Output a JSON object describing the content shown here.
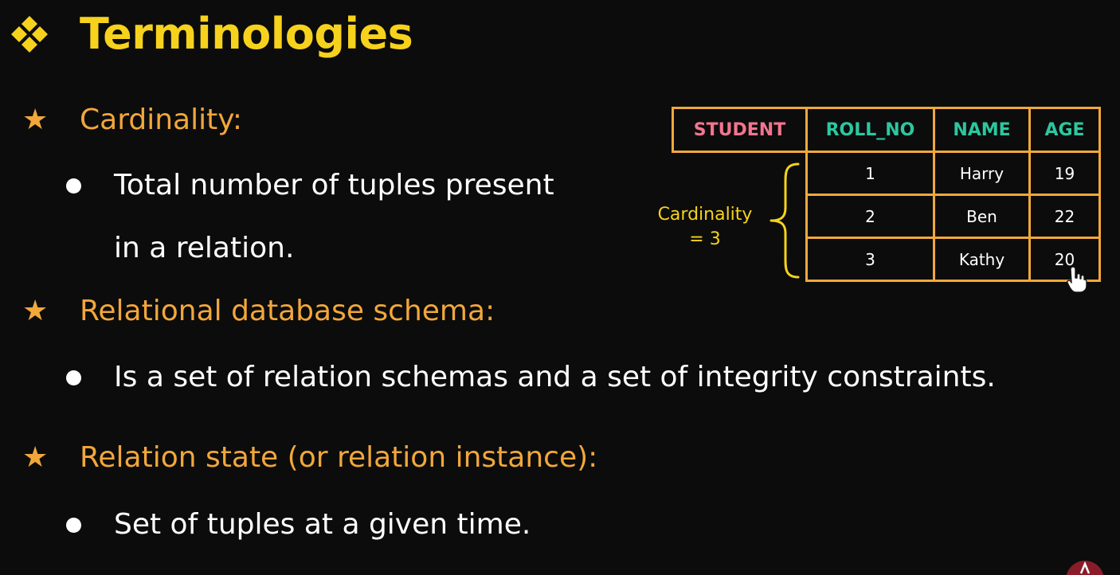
{
  "slide": {
    "title": "Terminologies",
    "sections": [
      {
        "heading": "Cardinality:",
        "bullets": [
          "Total number of tuples present",
          "in a relation."
        ]
      },
      {
        "heading": "Relational database schema:",
        "bullets": [
          "Is a set of relation schemas and a set of integrity constraints."
        ]
      },
      {
        "heading": "Relation state (or relation instance):",
        "bullets": [
          "Set of tuples at a given time."
        ]
      }
    ]
  },
  "table": {
    "name": "STUDENT",
    "columns": [
      "ROLL_NO",
      "NAME",
      "AGE"
    ],
    "rows": [
      [
        "1",
        "Harry",
        "19"
      ],
      [
        "2",
        "Ben",
        "22"
      ],
      [
        "3",
        "Kathy",
        "20"
      ]
    ]
  },
  "annotation": {
    "line1": "Cardinality",
    "line2": "= 3"
  },
  "colors": {
    "background": "#0c0c0c",
    "title": "#f6d21d",
    "heading": "#f2a73b",
    "body": "#ffffff",
    "table_border": "#f0a93a",
    "table_name": "#f3758e",
    "column_header": "#2cc7a0",
    "annotation": "#f6d21d"
  },
  "icons": {
    "title": "diamond-cluster-icon",
    "heading_marker": "star-icon",
    "bullet": "bullet-dot-icon",
    "pointer": "hand-pointer-icon"
  }
}
